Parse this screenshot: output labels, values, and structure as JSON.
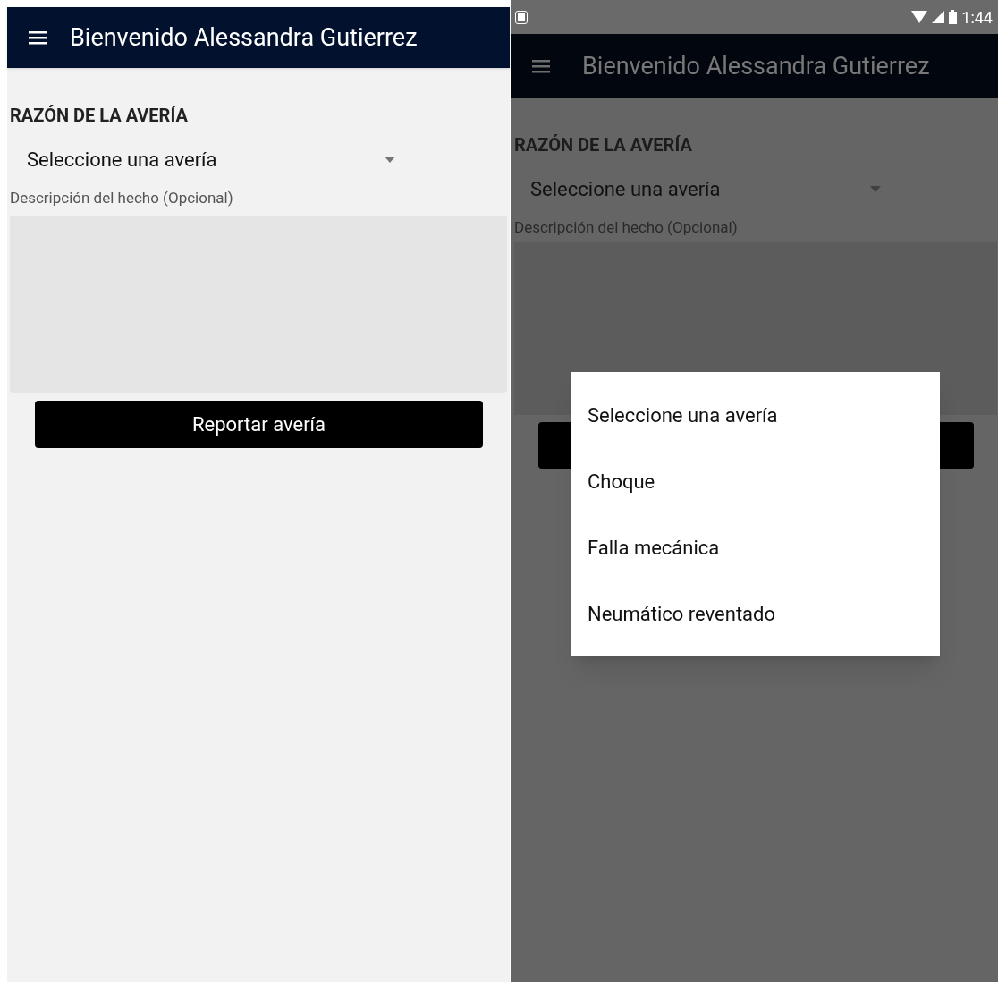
{
  "left_screen": {
    "app_bar": {
      "title": "Bienvenido Alessandra Gutierrez"
    },
    "section_label": "RAZÓN DE LA AVERÍA",
    "dropdown": {
      "value": "Seleccione una avería"
    },
    "description_label": "Descripción del hecho (Opcional)",
    "report_button": "Reportar avería"
  },
  "right_screen": {
    "status_bar": {
      "time": "1:44"
    },
    "app_bar": {
      "title": "Bienvenido Alessandra Gutierrez"
    },
    "section_label": "RAZÓN DE LA AVERÍA",
    "dropdown": {
      "value": "Seleccione una avería"
    },
    "description_label": "Descripción del hecho (Opcional)",
    "dialog": {
      "options": [
        {
          "label": "Seleccione una avería"
        },
        {
          "label": "Choque"
        },
        {
          "label": "Falla mecánica"
        },
        {
          "label": "Neumático reventado"
        }
      ]
    }
  }
}
